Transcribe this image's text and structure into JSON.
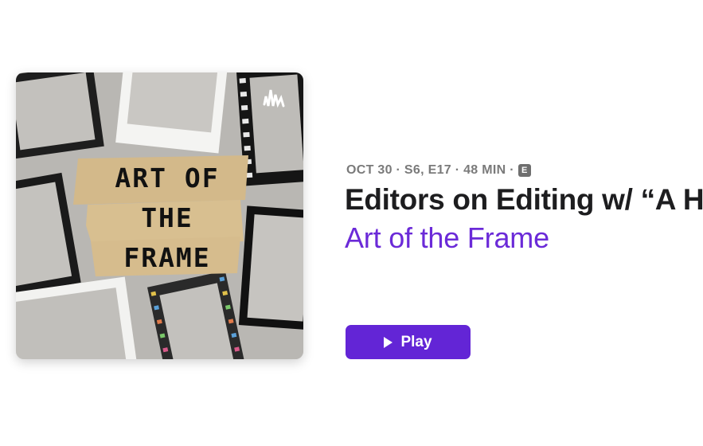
{
  "artwork": {
    "icon": "anchor-podcast-icon",
    "lines": [
      "ART OF",
      "THE",
      "FRAME"
    ]
  },
  "episode": {
    "meta": "OCT 30 · S6, E17 · 48 MIN ·",
    "explicit_badge": "E",
    "title": "Editors on Editing w/ “A H",
    "show": "Art of the Frame"
  },
  "play": {
    "label": "Play",
    "icon": "play-icon"
  },
  "colors": {
    "accent": "#6325d6",
    "show_name": "#6b2ad8",
    "meta": "#7a7a7a",
    "title": "#1d1d1f"
  }
}
